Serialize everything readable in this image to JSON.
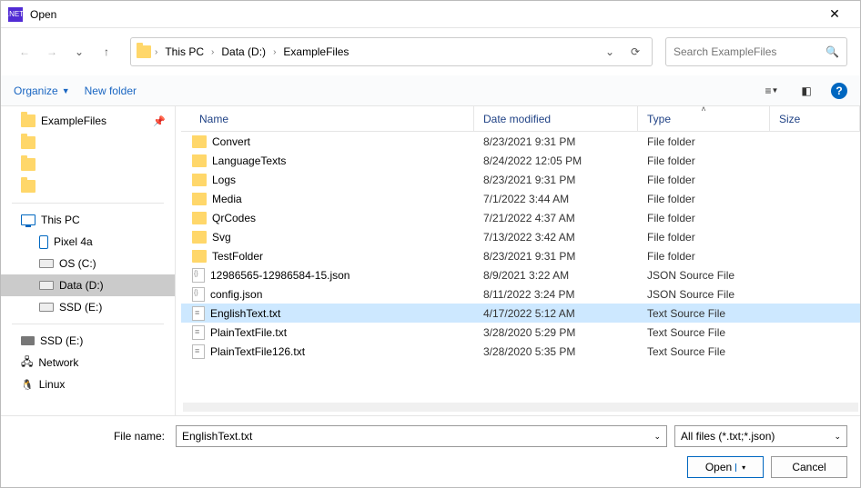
{
  "window": {
    "title": "Open"
  },
  "breadcrumbs": {
    "root_icon": "folder",
    "a": "This PC",
    "b": "Data (D:)",
    "c": "ExampleFiles"
  },
  "search": {
    "placeholder": "Search ExampleFiles"
  },
  "toolbar": {
    "organize": "Organize",
    "newfolder": "New folder"
  },
  "sidebar": {
    "quick": [
      {
        "label": "ExampleFiles",
        "icon": "folder",
        "pin": "📌"
      },
      {
        "label": "",
        "icon": "folder"
      },
      {
        "label": "",
        "icon": "folder"
      },
      {
        "label": "",
        "icon": "folder"
      }
    ],
    "pc_label": "This PC",
    "drives": [
      {
        "label": "Pixel 4a",
        "icon": "phone"
      },
      {
        "label": "OS (C:)",
        "icon": "drive"
      },
      {
        "label": "Data (D:)",
        "icon": "drive",
        "selected": true
      },
      {
        "label": "SSD (E:)",
        "icon": "drive"
      }
    ],
    "extra": [
      {
        "label": "SSD (E:)",
        "icon": "ssd"
      },
      {
        "label": "Network",
        "icon": "net"
      },
      {
        "label": "Linux",
        "icon": "linux"
      }
    ]
  },
  "columns": {
    "name": "Name",
    "date": "Date modified",
    "type": "Type",
    "size": "Size"
  },
  "files": [
    {
      "name": "Convert",
      "date": "8/23/2021 9:31 PM",
      "type": "File folder",
      "icon": "folder"
    },
    {
      "name": "LanguageTexts",
      "date": "8/24/2022 12:05 PM",
      "type": "File folder",
      "icon": "folder"
    },
    {
      "name": "Logs",
      "date": "8/23/2021 9:31 PM",
      "type": "File folder",
      "icon": "folder"
    },
    {
      "name": "Media",
      "date": "7/1/2022 3:44 AM",
      "type": "File folder",
      "icon": "folder"
    },
    {
      "name": "QrCodes",
      "date": "7/21/2022 4:37 AM",
      "type": "File folder",
      "icon": "folder"
    },
    {
      "name": "Svg",
      "date": "7/13/2022 3:42 AM",
      "type": "File folder",
      "icon": "folder"
    },
    {
      "name": "TestFolder",
      "date": "8/23/2021 9:31 PM",
      "type": "File folder",
      "icon": "folder"
    },
    {
      "name": "12986565-12986584-15.json",
      "date": "8/9/2021 3:22 AM",
      "type": "JSON Source File",
      "icon": "json"
    },
    {
      "name": "config.json",
      "date": "8/11/2022 3:24 PM",
      "type": "JSON Source File",
      "icon": "json"
    },
    {
      "name": "EnglishText.txt",
      "date": "4/17/2022 5:12 AM",
      "type": "Text Source File",
      "icon": "txt",
      "selected": true
    },
    {
      "name": "PlainTextFile.txt",
      "date": "3/28/2020 5:29 PM",
      "type": "Text Source File",
      "icon": "txt"
    },
    {
      "name": "PlainTextFile126.txt",
      "date": "3/28/2020 5:35 PM",
      "type": "Text Source File",
      "icon": "txt"
    }
  ],
  "footer": {
    "filename_label": "File name:",
    "filename_value": "EnglishText.txt",
    "filter": "All files (*.txt;*.json)",
    "open": "Open",
    "cancel": "Cancel"
  }
}
